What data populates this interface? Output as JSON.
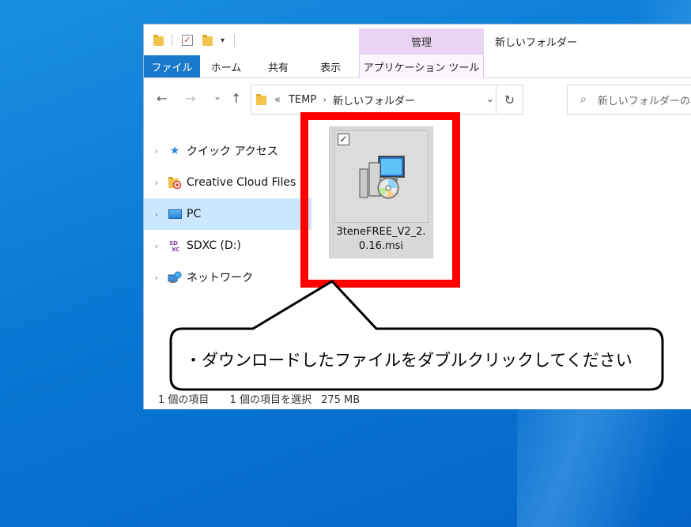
{
  "window": {
    "title": "新しいフォルダー",
    "manage_tab": "管理",
    "ribbon_tabs": [
      "ファイル",
      "ホーム",
      "共有",
      "表示",
      "アプリケーション ツール"
    ]
  },
  "address": {
    "back_icon": "←",
    "forward_icon": "→",
    "recent_icon": "⌄",
    "up_icon": "↑",
    "overflow": "«",
    "crumbs": [
      "TEMP",
      "新しいフォルダー"
    ],
    "dropdown_icon": "⌄",
    "refresh_icon": "↻"
  },
  "search": {
    "placeholder": "新しいフォルダーの検索"
  },
  "sidebar": {
    "items": [
      {
        "label": "クイック アクセス",
        "icon": "star-icon"
      },
      {
        "label": "Creative Cloud Files",
        "icon": "creative-cloud-icon"
      },
      {
        "label": "PC",
        "icon": "pc-icon"
      },
      {
        "label": "SDXC (D:)",
        "icon": "sdxc-icon"
      },
      {
        "label": "ネットワーク",
        "icon": "network-icon"
      }
    ],
    "active_index": 2
  },
  "file": {
    "name": "3teneFREE_V2_2.0.16.msi",
    "icon": "msi-installer-icon",
    "checked": true
  },
  "status": {
    "item_count": "1 個の項目",
    "selection": "1 個の項目を選択",
    "size": "275 MB"
  },
  "callout": {
    "text": "・ダウンロードしたファイルをダブルクリックしてください"
  },
  "colors": {
    "highlight": "#ff0000",
    "accent": "#1979ca",
    "selected": "#cce8ff",
    "manage_tab": "#e9d4f6"
  }
}
